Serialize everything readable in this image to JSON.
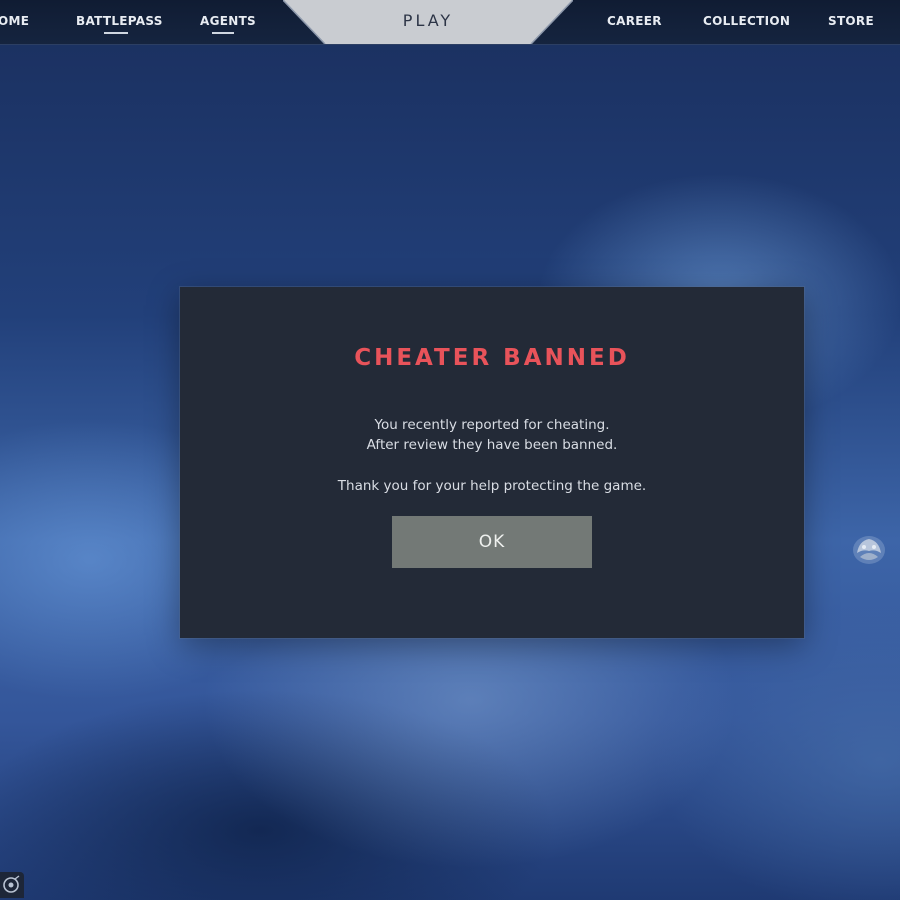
{
  "nav": {
    "left_items": [
      {
        "label": "OME"
      },
      {
        "label": "BATTLEPASS"
      },
      {
        "label": "AGENTS"
      }
    ],
    "center_tab": {
      "label": "PLAY"
    },
    "right_items": [
      {
        "label": "CAREER"
      },
      {
        "label": "COLLECTION"
      },
      {
        "label": "STORE"
      }
    ]
  },
  "dialog": {
    "title": "CHEATER BANNED",
    "message_line_1": "You recently reported  for cheating.",
    "message_line_2": "After review they have been banned.",
    "message_line_3": "Thank you for your help protecting the game.",
    "ok_label": "OK"
  },
  "colors": {
    "title_red": "#e8535a",
    "dialog_bg": "#232a37",
    "button_gray": "#737976",
    "nav_bg": "#101c33"
  },
  "icons": {
    "right_emblem": "agent-emblem-icon",
    "corner": "social-icon"
  }
}
